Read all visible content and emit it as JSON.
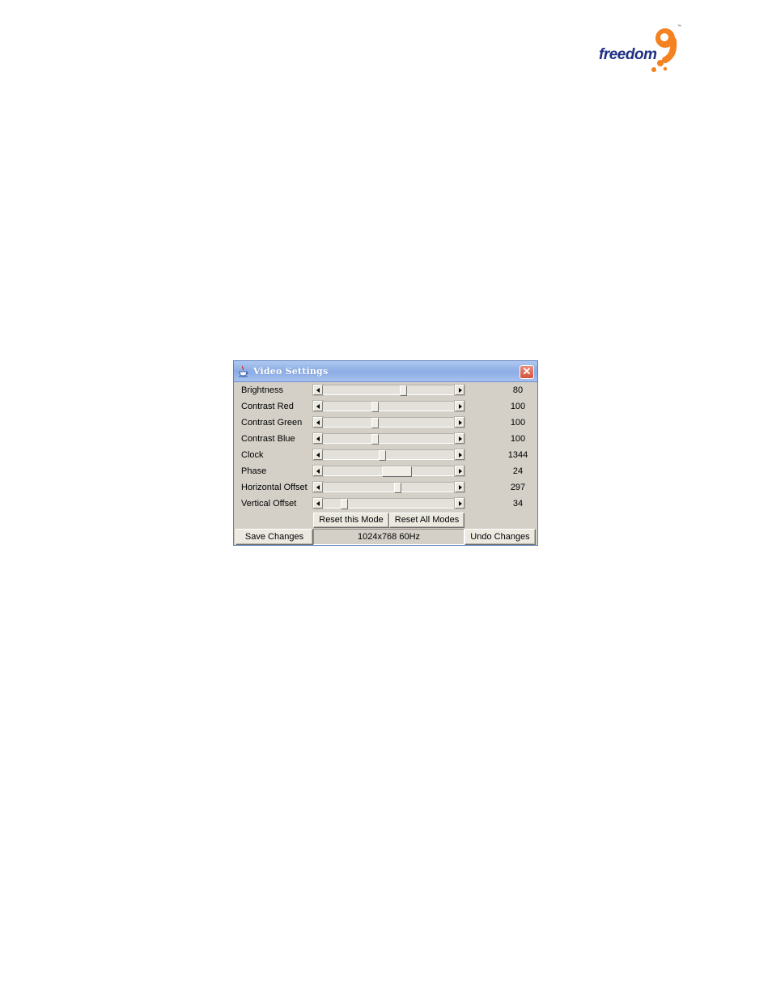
{
  "logo": {
    "word": "freedom",
    "digit": "9",
    "tm": "™"
  },
  "window": {
    "title": "Video Settings",
    "close_label": "✕"
  },
  "settings": [
    {
      "label": "Brightness",
      "value": "80",
      "level": 0.62
    },
    {
      "label": "Contrast Red",
      "value": "100",
      "level": 0.39
    },
    {
      "label": "Contrast Green",
      "value": "100",
      "level": 0.39
    },
    {
      "label": "Contrast Blue",
      "value": "100",
      "level": 0.39
    },
    {
      "label": "Clock",
      "value": "1344",
      "level": 0.45
    },
    {
      "label": "Phase",
      "value": "24",
      "level": 0.58
    },
    {
      "label": "Horizontal Offset",
      "value": "297",
      "level": 0.57
    },
    {
      "label": "Vertical Offset",
      "value": "34",
      "level": 0.14
    }
  ],
  "buttons": {
    "reset_mode": "Reset this Mode",
    "reset_all": "Reset All Modes",
    "save": "Save Changes",
    "undo": "Undo Changes"
  },
  "status": {
    "mode": "1024x768 60Hz"
  }
}
